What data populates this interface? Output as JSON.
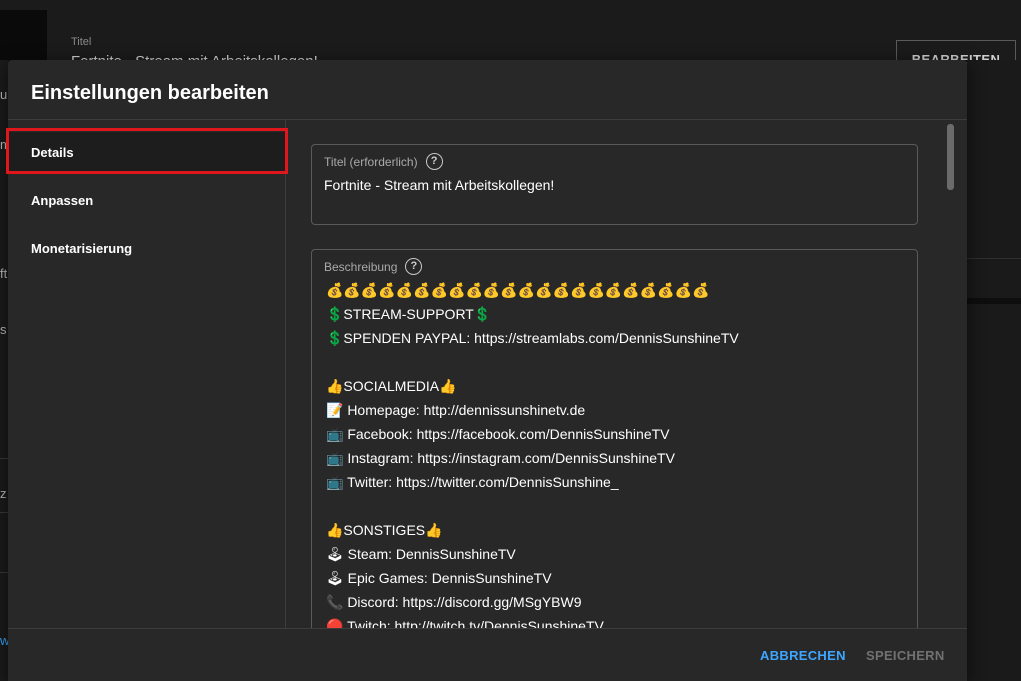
{
  "background": {
    "title_label": "Titel",
    "title_text": "Fortnite - Stream mit Arbeitskollegen!",
    "edit_button": "BEARBEITEN",
    "side_fragments": [
      "u",
      "m",
      "ft",
      "s",
      "z",
      "w"
    ]
  },
  "dialog": {
    "title": "Einstellungen bearbeiten",
    "nav": {
      "items": [
        {
          "label": "Details",
          "active": true
        },
        {
          "label": "Anpassen",
          "active": false
        },
        {
          "label": "Monetarisierung",
          "active": false
        }
      ]
    },
    "title_field": {
      "label": "Titel (erforderlich)",
      "help": "?",
      "value": "Fortnite - Stream mit Arbeitskollegen!"
    },
    "description_field": {
      "label": "Beschreibung",
      "help": "?",
      "lines": [
        "💰💰💰💰💰💰💰💰💰💰💰💰💰💰💰💰💰💰💰💰💰💰",
        "💲STREAM-SUPPORT💲",
        "💲SPENDEN PAYPAL: https://streamlabs.com/DennisSunshineTV",
        "",
        "👍SOCIALMEDIA👍",
        "📝 Homepage: http://dennissunshinetv.de",
        "📺 Facebook: https://facebook.com/DennisSunshineTV",
        "📺 Instagram: https://instagram.com/DennisSunshineTV",
        "📺 Twitter: https://twitter.com/DennisSunshine_",
        "",
        "👍SONSTIGES👍",
        "🕹 Steam: DennisSunshineTV",
        "🕹 Epic Games: DennisSunshineTV",
        "📞 Discord: https://discord.gg/MSgYBW9",
        "🔴 Twitch: http://twitch.tv/DennisSunshineTV"
      ]
    },
    "footer": {
      "cancel": "ABBRECHEN",
      "save": "SPEICHERN"
    }
  },
  "colors": {
    "accent": "#3ea6ff",
    "highlight": "#e0161d",
    "dialog_bg": "#282828"
  }
}
